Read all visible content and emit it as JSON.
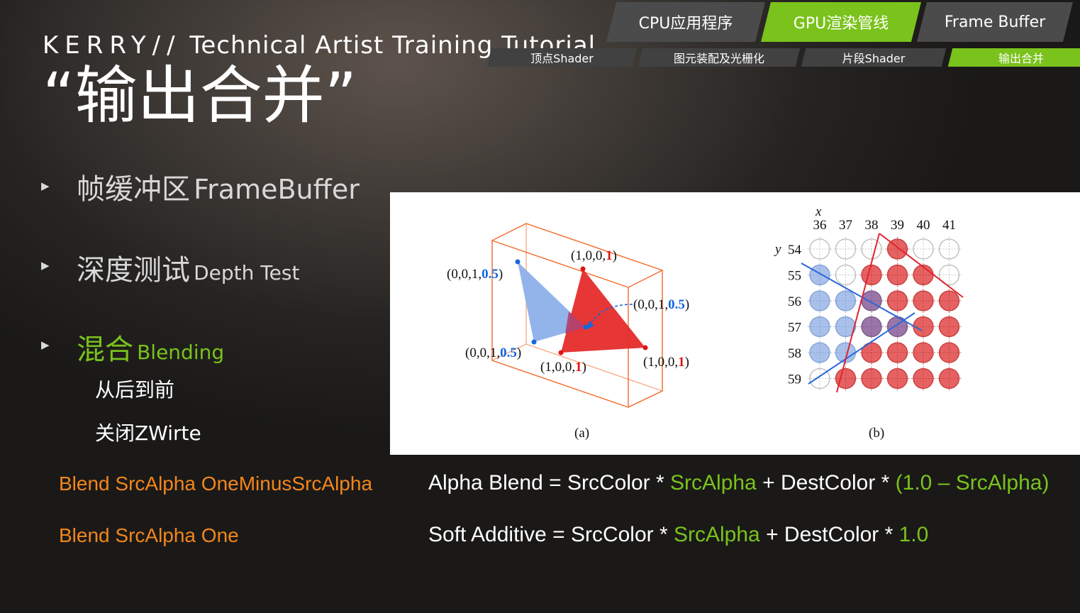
{
  "header": {
    "prefix": "KERRY//",
    "subtitle": "Technical Artist Training Tutorial",
    "title": "“输出合并”"
  },
  "nav": {
    "tabs": [
      {
        "label": "CPU应用程序",
        "active": false
      },
      {
        "label": "GPU渲染管线",
        "active": true
      },
      {
        "label": "Frame Buffer",
        "active": false
      }
    ],
    "subtabs": [
      {
        "label": "顶点Shader",
        "active": false
      },
      {
        "label": "图元装配及光栅化",
        "active": false
      },
      {
        "label": "片段Shader",
        "active": false
      },
      {
        "label": "输出合并",
        "active": true
      }
    ]
  },
  "bullets": [
    {
      "zh": "帧缓冲区",
      "en": "FrameBuffer",
      "highlight": false
    },
    {
      "zh": "深度测试",
      "en": "Depth Test",
      "highlight": false
    },
    {
      "zh": "混合",
      "en": "Blending",
      "highlight": true
    }
  ],
  "sub_items": [
    "从后到前",
    "关闭ZWirte"
  ],
  "figure": {
    "a": {
      "caption": "(a)",
      "labels": {
        "blue_top": {
          "pre": "(0,0,1,",
          "val": "0.5",
          "post": ")"
        },
        "blue_bottom": {
          "pre": "(0,0,1,",
          "val": "0.5",
          "post": ")"
        },
        "red_top": {
          "pre": "(1,0,0,",
          "val": "1",
          "post": ")"
        },
        "red_left": {
          "pre": "(1,0,0,",
          "val": "1",
          "post": ")"
        },
        "red_right": {
          "pre": "(1,0,0,",
          "val": "1",
          "post": ")"
        },
        "arrow": {
          "pre": "(0,0,1,",
          "val": "0.5",
          "post": ")"
        }
      }
    },
    "b": {
      "caption": "(b)",
      "x_label": "x",
      "y_label": "y",
      "x_ticks": [
        "36",
        "37",
        "38",
        "39",
        "40",
        "41"
      ],
      "y_ticks": [
        "54",
        "55",
        "56",
        "57",
        "58",
        "59"
      ],
      "grid": [
        [
          "empty",
          "empty",
          "empty",
          "red",
          "empty",
          "empty"
        ],
        [
          "blue",
          "empty",
          "red",
          "red",
          "red",
          "empty"
        ],
        [
          "blue",
          "blue",
          "purple",
          "red",
          "red",
          "red"
        ],
        [
          "blue",
          "blue",
          "purple",
          "purple",
          "red",
          "red"
        ],
        [
          "blue",
          "blue",
          "red",
          "red",
          "red",
          "red"
        ],
        [
          "empty",
          "red",
          "red",
          "red",
          "red",
          "red"
        ]
      ]
    }
  },
  "code_lines": [
    "Blend SrcAlpha OneMinusSrcAlpha",
    "Blend SrcAlpha One"
  ],
  "equations": [
    {
      "lhs": "Alpha Blend = SrcColor * ",
      "src": "SrcAlpha",
      "mid": " + DestColor * ",
      "factor": "(1.0 – SrcAlpha)"
    },
    {
      "lhs": "Soft Additive = SrcColor * ",
      "src": "SrcAlpha",
      "mid": " + DestColor * ",
      "factor": "1.0"
    }
  ],
  "colors": {
    "accent_green": "#7ac21c",
    "code_orange": "#f3861b",
    "tab_gray": "#4b4b4b",
    "blue_cell": "#a9c1ea",
    "red_cell": "#e66262",
    "purple_cell": "#9a76a8",
    "box_orange": "#f36a2a"
  }
}
